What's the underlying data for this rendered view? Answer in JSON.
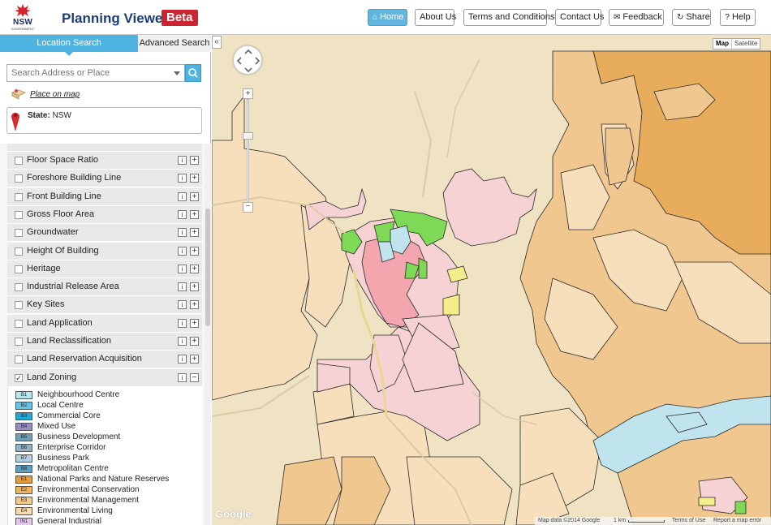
{
  "header": {
    "logo_text": "NSW",
    "logo_sub": "GOVERNMENT",
    "title": "Planning Viewer",
    "badge": "Beta",
    "nav": [
      {
        "label": "Home",
        "icon": "home-icon"
      },
      {
        "label": "About Us"
      },
      {
        "label": "Terms and Conditions"
      },
      {
        "label": "Contact Us"
      },
      {
        "label": "Feedback",
        "icon": "megaphone-icon"
      },
      {
        "label": "Share",
        "icon": "share-icon"
      },
      {
        "label": "Help",
        "icon": "help-icon"
      }
    ]
  },
  "sidebar": {
    "tabs": {
      "location": "Location Search",
      "advanced": "Advanced Search"
    },
    "search": {
      "placeholder": "Search Address or Place",
      "value": ""
    },
    "place_on_map": "Place on map",
    "state": {
      "label": "State:",
      "value": "NSW"
    },
    "layers": [
      {
        "label": "Floor Space Ratio",
        "checked": false
      },
      {
        "label": "Foreshore Building Line",
        "checked": false
      },
      {
        "label": "Front Building Line",
        "checked": false
      },
      {
        "label": "Gross Floor Area",
        "checked": false
      },
      {
        "label": "Groundwater",
        "checked": false
      },
      {
        "label": "Height Of Building",
        "checked": false
      },
      {
        "label": "Heritage",
        "checked": false
      },
      {
        "label": "Industrial Release Area",
        "checked": false
      },
      {
        "label": "Key Sites",
        "checked": false
      },
      {
        "label": "Land Application",
        "checked": false
      },
      {
        "label": "Land Reclassification",
        "checked": false
      },
      {
        "label": "Land Reservation Acquisition",
        "checked": false
      },
      {
        "label": "Land Zoning",
        "checked": true
      }
    ],
    "info_glyph": "i",
    "expand_glyph": "+",
    "collapse_glyph": "−",
    "check_glyph": "✓",
    "legend": [
      {
        "code": "B1",
        "name": "Neighbourhood Centre",
        "color": "#b7e6ee"
      },
      {
        "code": "B2",
        "name": "Local Centre",
        "color": "#63c6e6"
      },
      {
        "code": "B3",
        "name": "Commercial Core",
        "color": "#1fa7d6"
      },
      {
        "code": "B4",
        "name": "Mixed Use",
        "color": "#9a8cc4"
      },
      {
        "code": "B5",
        "name": "Business Development",
        "color": "#6f9fb4"
      },
      {
        "code": "B6",
        "name": "Enterprise Corridor",
        "color": "#8fb3c2"
      },
      {
        "code": "B7",
        "name": "Business Park",
        "color": "#b5cfe0"
      },
      {
        "code": "B8",
        "name": "Metropolitan Centre",
        "color": "#5b9fc1"
      },
      {
        "code": "E1",
        "name": "National Parks and Nature Reserves",
        "color": "#e49c3e"
      },
      {
        "code": "E2",
        "name": "Environmental Conservation",
        "color": "#f0b35a"
      },
      {
        "code": "E3",
        "name": "Environmental Management",
        "color": "#f5c98a"
      },
      {
        "code": "E4",
        "name": "Environmental Living",
        "color": "#f9dcaa"
      },
      {
        "code": "IN1",
        "name": "General Industrial",
        "color": "#e2c8ec"
      }
    ]
  },
  "map": {
    "collapse_glyph": "«",
    "zoom_in": "+",
    "zoom_out": "−",
    "type_map": "Map",
    "type_satellite": "Satellite",
    "google_logo": "Google",
    "attribution": {
      "data": "Map data ©2014 Google",
      "scale": "1 km",
      "terms": "Terms of Use",
      "report": "Report a map error"
    },
    "colors": {
      "background": "#efe3c4",
      "zone_light": "#f7dfbc",
      "zone_mid": "#f1c790",
      "zone_dark": "#e7ad5c",
      "residential": "#f6d2d4",
      "business": "#f4a6ae",
      "recreation": "#7ed957",
      "water": "#bfe4ee",
      "special": "#f3ee8a"
    }
  }
}
